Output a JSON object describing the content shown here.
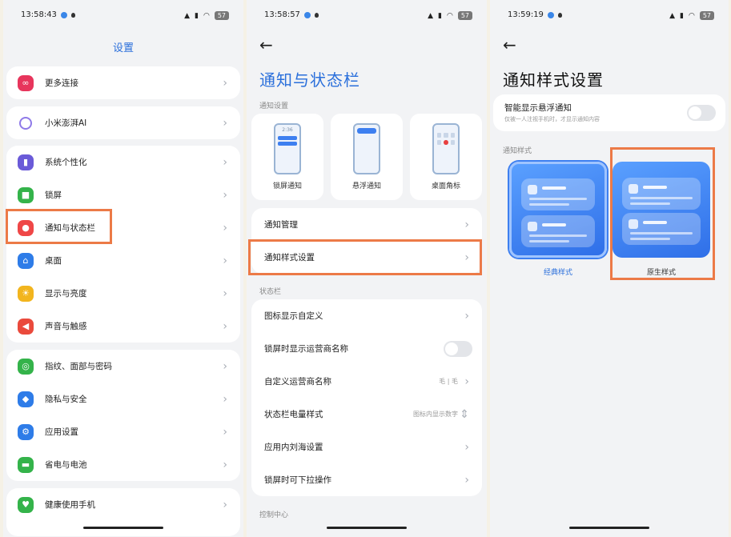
{
  "panel1": {
    "status": {
      "time": "13:58:43",
      "battery": "57"
    },
    "title": "设置",
    "items": [
      {
        "label": "更多连接",
        "icon": "link-icon",
        "color": "#e7355c"
      },
      {
        "label": "小米澎湃AI",
        "icon": "ai-icon",
        "color": "#8f7ae8"
      },
      {
        "label": "系统个性化",
        "icon": "brush-icon",
        "color": "#6a5ad8"
      },
      {
        "label": "锁屏",
        "icon": "lock-icon",
        "color": "#34b34a"
      },
      {
        "label": "通知与状态栏",
        "icon": "notification-icon",
        "color": "#ef4747"
      },
      {
        "label": "桌面",
        "icon": "home-icon",
        "color": "#2e7ce8"
      },
      {
        "label": "显示与亮度",
        "icon": "sun-icon",
        "color": "#f2b51e"
      },
      {
        "label": "声音与触感",
        "icon": "sound-icon",
        "color": "#ea4a3c"
      },
      {
        "label": "指纹、面部与密码",
        "icon": "fingerprint-icon",
        "color": "#34b34a"
      },
      {
        "label": "隐私与安全",
        "icon": "privacy-icon",
        "color": "#2e7ce8"
      },
      {
        "label": "应用设置",
        "icon": "gear-icon",
        "color": "#2e7ce8"
      },
      {
        "label": "省电与电池",
        "icon": "battery-icon",
        "color": "#34b34a"
      },
      {
        "label": "健康使用手机",
        "icon": "health-icon",
        "color": "#34b34a"
      }
    ]
  },
  "panel2": {
    "status": {
      "time": "13:58:57",
      "battery": "57"
    },
    "title": "通知与状态栏",
    "sec_notify": "通知设置",
    "tiles": [
      "锁屏通知",
      "悬浮通知",
      "桌面角标"
    ],
    "rows1": [
      "通知管理",
      "通知样式设置"
    ],
    "sec_status": "状态栏",
    "rows2": [
      {
        "label": "图标显示自定义",
        "value": ""
      },
      {
        "label": "锁屏时显示运营商名称",
        "value": ""
      },
      {
        "label": "自定义运营商名称",
        "value": "毛 | 毛"
      },
      {
        "label": "状态栏电量样式",
        "value": "图标内显示数字"
      },
      {
        "label": "应用内刘海设置",
        "value": ""
      },
      {
        "label": "锁屏时可下拉操作",
        "value": ""
      }
    ],
    "sec_control": "控制中心",
    "tile_time": "2:36"
  },
  "panel3": {
    "status": {
      "time": "13:59:19",
      "battery": "57"
    },
    "title": "通知样式设置",
    "smart_label": "智能显示悬浮通知",
    "smart_desc": "仅被一人注视手机时，才显示通知内容",
    "sec_style": "通知样式",
    "style1": "经典样式",
    "style2": "原生样式"
  },
  "colors": {
    "accent": "#2a6fdb",
    "highlight": "#ec7a47"
  }
}
